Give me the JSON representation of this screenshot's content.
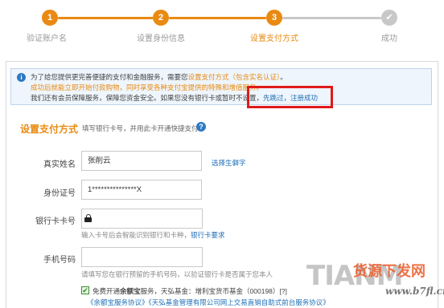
{
  "colors": {
    "accent": "#e98a12",
    "link": "#1f6fb5",
    "highlight": "#e01a1a",
    "done": "#c8c8c8"
  },
  "steps": [
    {
      "number": "1",
      "label": "验证账户名",
      "state": "done"
    },
    {
      "number": "2",
      "label": "设置身份信息",
      "state": "done"
    },
    {
      "number": "3",
      "label": "设置支付方式",
      "state": "active"
    },
    {
      "number": "✔",
      "label": "成功",
      "state": "pending"
    }
  ],
  "notice": {
    "line1_a": "为了给您提供更完善便捷的支付和金融服务，需要您",
    "line1_b": "设置支付方式（包含实名认证）",
    "line1_c": "。",
    "line2": "成功后就能立即开始付款购物，同时享受各种支付宝提供的特殊和增值服务。",
    "line3_a": "我们还有会员保障服务，保障您资金安全。如果您没有银行卡或暂时不设置，",
    "line3_link": "先跳过，注册成功"
  },
  "section": {
    "title": "设置支付方式",
    "subtitle": "填写银行卡号，并用此卡开通快捷支付"
  },
  "form": {
    "name_label": "真实姓名",
    "name_value": "张削云",
    "name_extra": "选择生僻字",
    "id_label": "身份证号",
    "id_value": "1***************X",
    "card_label": "银行卡卡号",
    "card_hint_a": "输入卡号后会智能识别银行和卡种，",
    "card_hint_link": "银行卡要求",
    "phone_label": "手机号码",
    "phone_hint": "请填写您在银行预留的手机号码，以验证银行卡是否属于您本人",
    "agree_check": "✔",
    "agree_line1_a": "免费开通",
    "agree_line1_b": "余额宝",
    "agree_line1_c": "服务，天弘基金：增利宝货币基金（000198）[?]",
    "agree_line2": "《余额宝服务协议》《天弘基金管理有限公司网上交易直销自助式前台服务协议》"
  },
  "watermark": {
    "brand": "TIANM",
    "cn": "货源下发网",
    "url": "www.b7fl.cn"
  }
}
